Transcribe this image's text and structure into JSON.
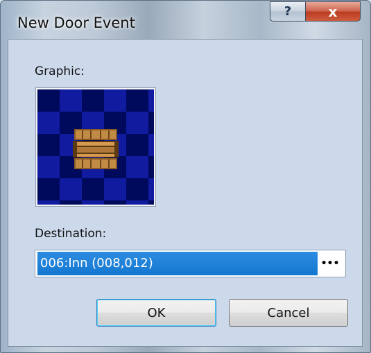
{
  "window": {
    "title": "New Door Event"
  },
  "caption": {
    "help_glyph": "?",
    "close_glyph": "x"
  },
  "form": {
    "graphic_label": "Graphic:",
    "graphic_icon": "door-icon",
    "destination_label": "Destination:",
    "destination_value": "006:Inn (008,012)",
    "browse_label": "•••"
  },
  "buttons": {
    "ok_label": "OK",
    "cancel_label": "Cancel"
  },
  "colors": {
    "selection": "#1a7fd6",
    "tile_dark": "#000a5c",
    "tile_light": "#101b9f",
    "door_wood": "#b07a3a"
  }
}
